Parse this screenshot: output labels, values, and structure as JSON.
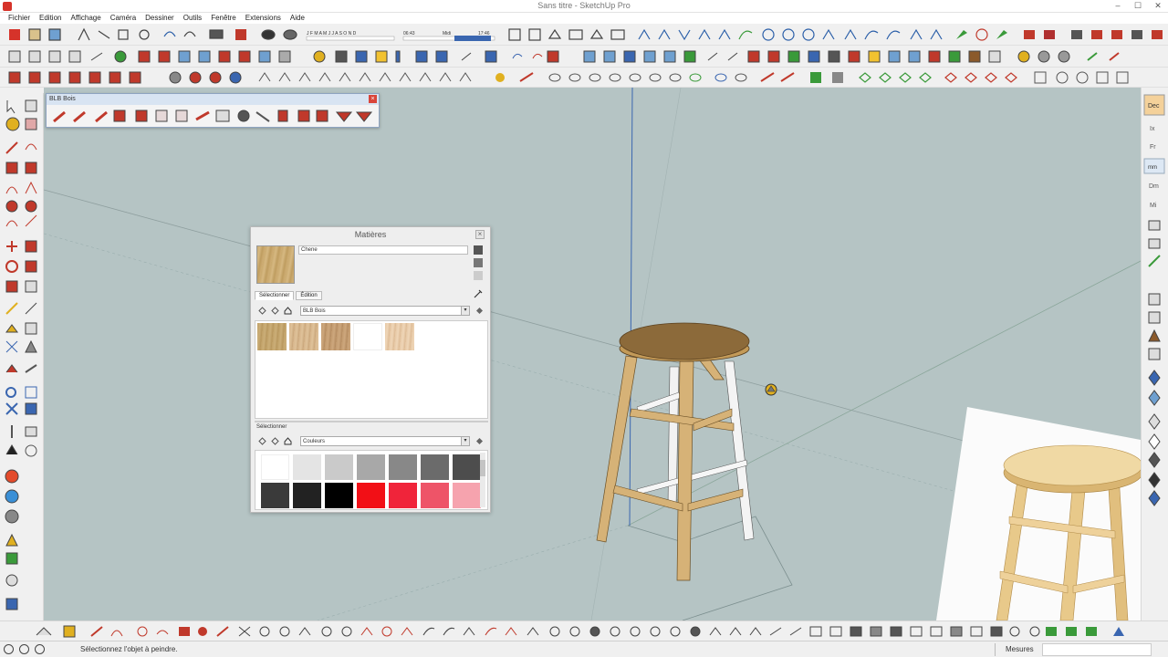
{
  "window": {
    "title": "Sans titre - SketchUp Pro"
  },
  "menu": [
    "Fichier",
    "Edition",
    "Affichage",
    "Caméra",
    "Dessiner",
    "Outils",
    "Fenêtre",
    "Extensions",
    "Aide"
  ],
  "shadow_bar": {
    "months": "J F M A M J J A S O N D",
    "time_start": "06:43",
    "time_mid": "Midi",
    "time_end": "17:46"
  },
  "blb_toolbar": {
    "title": "BLB Bois"
  },
  "materials": {
    "title": "Matières",
    "material_name": "Chene",
    "tabs": [
      "Sélectionner",
      "Édition"
    ],
    "library": "BLB Bois",
    "section2_title": "Sélectionner",
    "library2": "Couleurs",
    "wood_swatches": [
      "#c0a067",
      "#d6b48a",
      "#c29a6e",
      "#ffffff",
      "#e6c7a4"
    ],
    "color_swatches": [
      [
        "#ffffff",
        "#e4e4e4",
        "#cacaca",
        "#a8a8a8",
        "#888888",
        "#6b6b6b",
        "#4d4d4d"
      ],
      [
        "#3a3a3a",
        "#222222",
        "#000000",
        "#f20f16",
        "#f0243a",
        "#ee5468",
        "#f6a3ae"
      ]
    ]
  },
  "statusbar": {
    "message": "Sélectionnez l'objet à peindre.",
    "measure_label": "Mesures"
  },
  "colors": {
    "viewport_bg": "#b5c4c4",
    "wood": "#d6b277",
    "wood_dark": "#8a6a3a",
    "seat_top": "#8c6a3a",
    "accent_red": "#d6332a"
  }
}
